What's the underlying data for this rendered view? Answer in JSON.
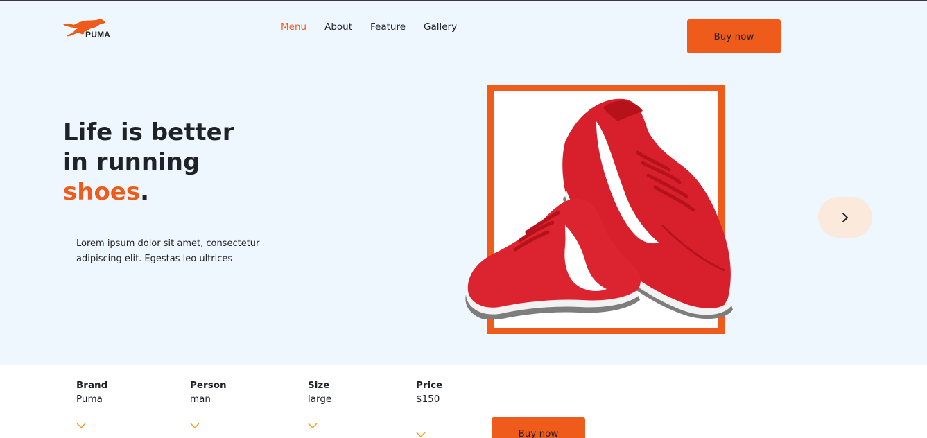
{
  "brand": {
    "name": "PUMA",
    "logo_icon": "puma-cat-icon",
    "accent_color": "#ef5b1a"
  },
  "nav": {
    "items": [
      {
        "label": "Menu",
        "active": true
      },
      {
        "label": "About",
        "active": false
      },
      {
        "label": "Feature",
        "active": false
      },
      {
        "label": "Gallery",
        "active": false
      }
    ]
  },
  "header": {
    "buy_label": "Buy now"
  },
  "hero": {
    "line1": "Life is better",
    "line2": "in running",
    "accent_word": "shoes",
    "period": ".",
    "description": "Lorem ipsum dolor sit amet, consectetur adipiscing elit. Egestas leo ultrices",
    "next_icon": "chevron-right-icon"
  },
  "specs": [
    {
      "label": "Brand",
      "value": "Puma"
    },
    {
      "label": "Person",
      "value": "man"
    },
    {
      "label": "Size",
      "value": "large"
    },
    {
      "label": "Price",
      "value": "$150"
    }
  ],
  "footer_buy_label": "Buy now"
}
